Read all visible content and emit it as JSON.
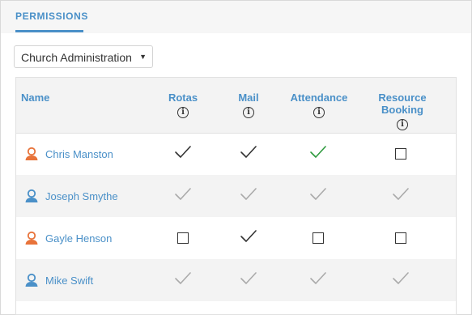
{
  "tab": {
    "label": "PERMISSIONS"
  },
  "group_select": {
    "value": "Church Administration"
  },
  "columns": [
    "Name",
    "Rotas",
    "Mail",
    "Attendance",
    "Resource Booking"
  ],
  "rows": [
    {
      "name": "Chris Manston",
      "gender": "female",
      "cells": [
        "check",
        "check",
        "check-green",
        "box"
      ]
    },
    {
      "name": "Joseph Smythe",
      "gender": "male",
      "cells": [
        "check-faded",
        "check-faded",
        "check-faded",
        "check-faded"
      ]
    },
    {
      "name": "Gayle Henson",
      "gender": "female",
      "cells": [
        "box",
        "check",
        "box",
        "box"
      ]
    },
    {
      "name": "Mike Swift",
      "gender": "male",
      "cells": [
        "check-faded",
        "check-faded",
        "check-faded",
        "check-faded"
      ]
    }
  ],
  "colors": {
    "accent": "#4a90c8",
    "female_icon": "#e8733a",
    "male_icon": "#4a90c8",
    "check": "#333333",
    "check_green": "#2e9a3e",
    "check_faded": "#aaaaaa"
  }
}
